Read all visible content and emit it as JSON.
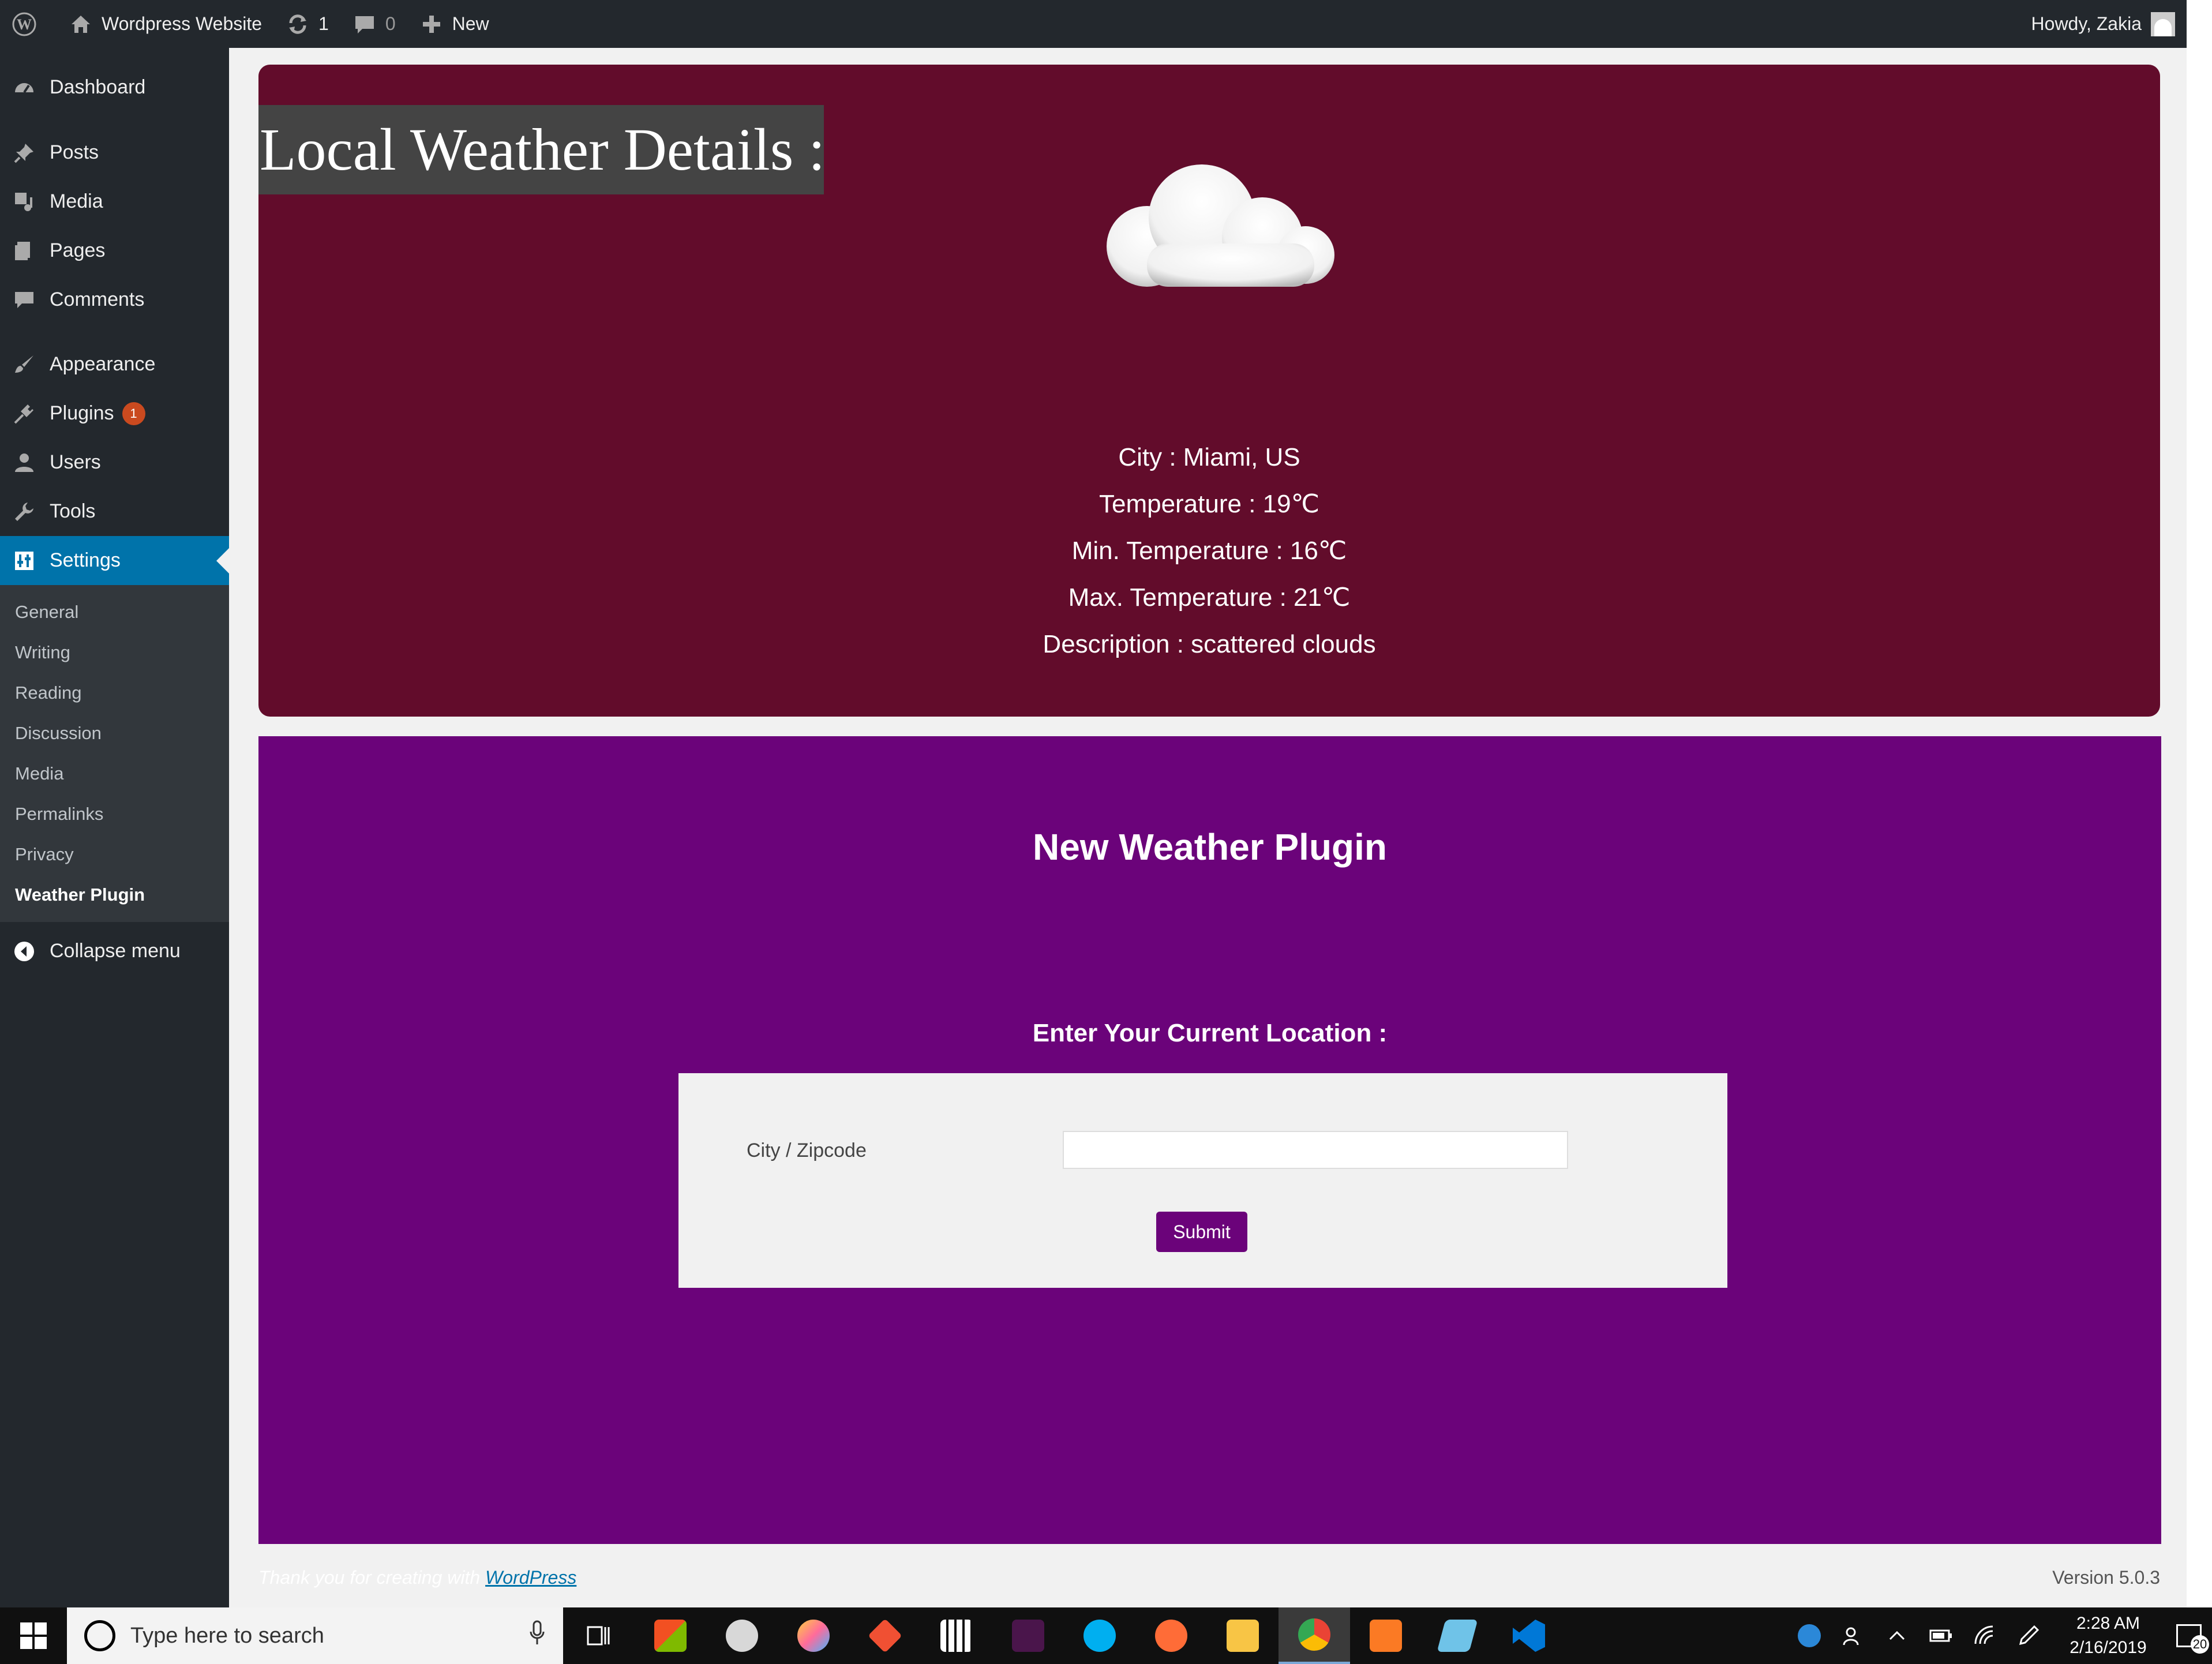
{
  "adminbar": {
    "site_name": "Wordpress Website",
    "updates_count": "1",
    "comments_count": "0",
    "new_label": "New",
    "howdy": "Howdy, Zakia"
  },
  "sidebar": {
    "items": [
      {
        "label": "Dashboard",
        "icon": "dashboard-icon"
      },
      {
        "label": "Posts",
        "icon": "pin-icon"
      },
      {
        "label": "Media",
        "icon": "media-icon"
      },
      {
        "label": "Pages",
        "icon": "pages-icon"
      },
      {
        "label": "Comments",
        "icon": "comment-icon"
      },
      {
        "label": "Appearance",
        "icon": "brush-icon"
      },
      {
        "label": "Plugins",
        "icon": "plugin-icon",
        "badge": "1"
      },
      {
        "label": "Users",
        "icon": "user-icon"
      },
      {
        "label": "Tools",
        "icon": "wrench-icon"
      },
      {
        "label": "Settings",
        "icon": "settings-icon",
        "active": true
      }
    ],
    "submenu": [
      "General",
      "Writing",
      "Reading",
      "Discussion",
      "Media",
      "Permalinks",
      "Privacy",
      "Weather Plugin"
    ],
    "current_submenu": "Weather Plugin",
    "collapse_label": "Collapse menu"
  },
  "weather": {
    "title": "Local Weather Details :",
    "icon": "cloud-icon",
    "city": "City : Miami, US",
    "temperature": "Temperature : 19℃",
    "min_temperature": "Min. Temperature : 16℃",
    "max_temperature": "Max. Temperature : 21℃",
    "description": "Description : scattered clouds"
  },
  "plugin": {
    "title": "New Weather Plugin",
    "location_label": "Enter Your Current Location :",
    "field_label": "City / Zipcode",
    "input_value": "",
    "submit_label": "Submit"
  },
  "footer": {
    "thanks_text": "Thank you for creating with ",
    "link_text": "WordPress",
    "version": "Version 5.0.3"
  },
  "taskbar": {
    "search_placeholder": "Type here to search",
    "time": "2:28 AM",
    "date": "2/16/2019",
    "notification_count": "20"
  },
  "colors": {
    "admin_dark": "#23282d",
    "admin_blue": "#0073aa",
    "weather_box": "#620c2b",
    "plugin_box": "#6b037a",
    "badge": "#ca4a1f"
  }
}
